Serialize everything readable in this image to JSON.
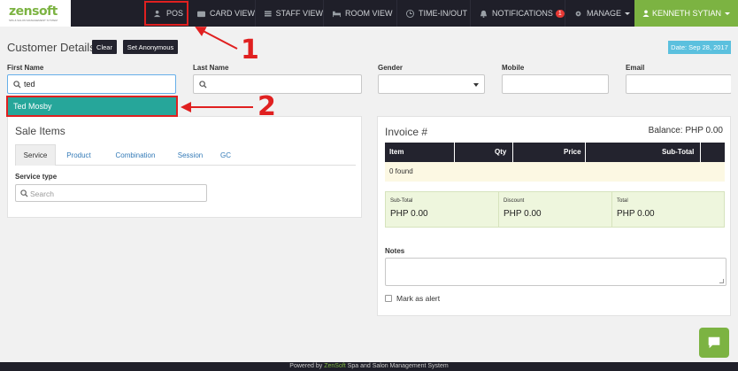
{
  "brand": {
    "name": "zensoft",
    "tagline": "SPA & SALON MANAGEMENT SYSTEM"
  },
  "nav": {
    "pos": "POS",
    "card_view": "CARD VIEW",
    "staff_view": "STAFF VIEW",
    "room_view": "ROOM VIEW",
    "time_in_out": "TIME-IN/OUT",
    "notifications": "NOTIFICATIONS",
    "notifications_count": "1",
    "manage": "MANAGE",
    "user": "KENNETH SYTIAN"
  },
  "customer": {
    "title": "Customer Details",
    "clear_label": "Clear",
    "anonymous_label": "Set Anonymous",
    "date": "Date: Sep 28, 2017",
    "first_name_label": "First Name",
    "first_name_value": "ted",
    "last_name_label": "Last Name",
    "last_name_value": "",
    "gender_label": "Gender",
    "gender_value": "",
    "mobile_label": "Mobile",
    "mobile_value": "",
    "email_label": "Email",
    "email_value": "",
    "suggestion": "Ted Mosby"
  },
  "annotations": {
    "step1": "1",
    "step2": "2",
    "color": "#e02020"
  },
  "sale": {
    "title": "Sale Items",
    "tabs": [
      "Service",
      "Product",
      "Combination",
      "Session",
      "GC"
    ],
    "active_tab": "Service",
    "service_type_label": "Service type",
    "search_placeholder": "Search"
  },
  "invoice": {
    "title": "Invoice #",
    "balance": "Balance: PHP 0.00",
    "columns": [
      "Item",
      "Qty",
      "Price",
      "Sub-Total"
    ],
    "empty_text": "0 found",
    "subtotal_label": "Sub-Total",
    "subtotal_value": "PHP 0.00",
    "discount_label": "Discount",
    "discount_value": "PHP 0.00",
    "total_label": "Total",
    "total_value": "PHP 0.00",
    "notes_label": "Notes",
    "notes_value": "",
    "alert_label": "Mark as alert",
    "alert_checked": false
  },
  "footer": {
    "prefix": "Powered by ",
    "brand": "ZenSoft",
    "suffix": " Spa and Salon Management System"
  },
  "colors": {
    "accent_green": "#7cb342",
    "teal": "#26a69a",
    "nav_bg": "#1f1f29",
    "info": "#5bc0de"
  }
}
